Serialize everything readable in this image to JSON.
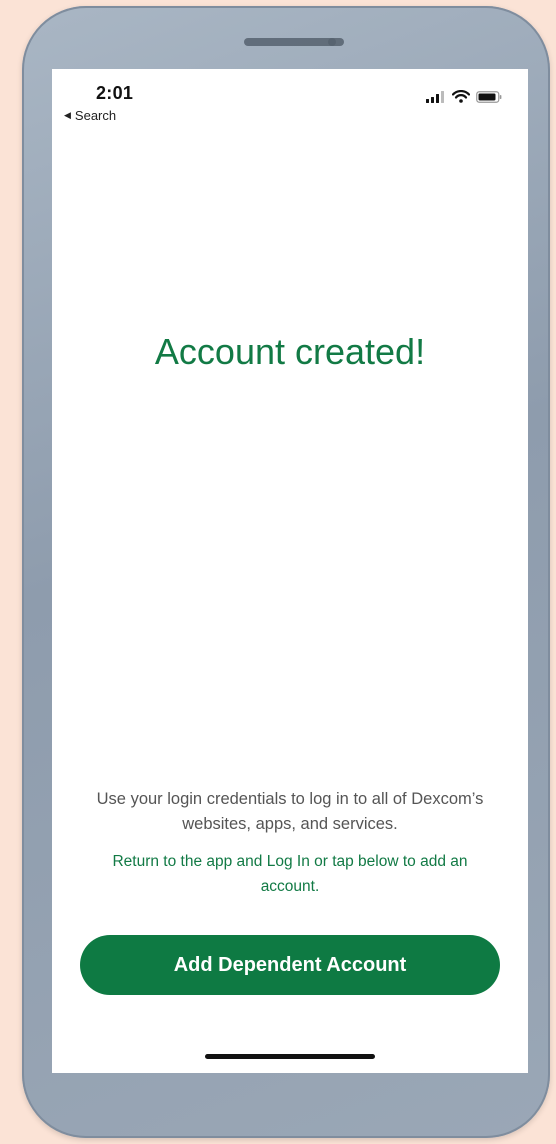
{
  "status_bar": {
    "time": "2:01",
    "back_label": "Search"
  },
  "icons": {
    "back": "back-triangle-icon",
    "signal": "cellular-signal-icon",
    "wifi": "wifi-icon",
    "battery": "battery-icon"
  },
  "main": {
    "headline": "Account created!",
    "info_text": "Use your login credentials to log in to all of Dexcom’s websites, apps, and services.",
    "prompt_text": "Return to the app and Log In or tap below to add an account.",
    "add_button_label": "Add Dependent Account"
  },
  "colors": {
    "brand_green": "#127a45",
    "button_green": "#0e7a43",
    "background_peach": "#fbe3d6",
    "device_frame": "#9aa7b6"
  }
}
